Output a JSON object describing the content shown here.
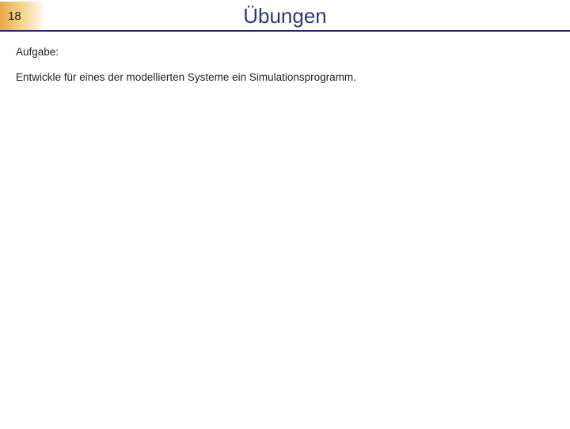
{
  "header": {
    "page_number": "18",
    "title": "Übungen"
  },
  "content": {
    "task_label": "Aufgabe:",
    "task_body": "Entwickle für eines der modellierten Systeme ein Simulationsprogramm."
  }
}
